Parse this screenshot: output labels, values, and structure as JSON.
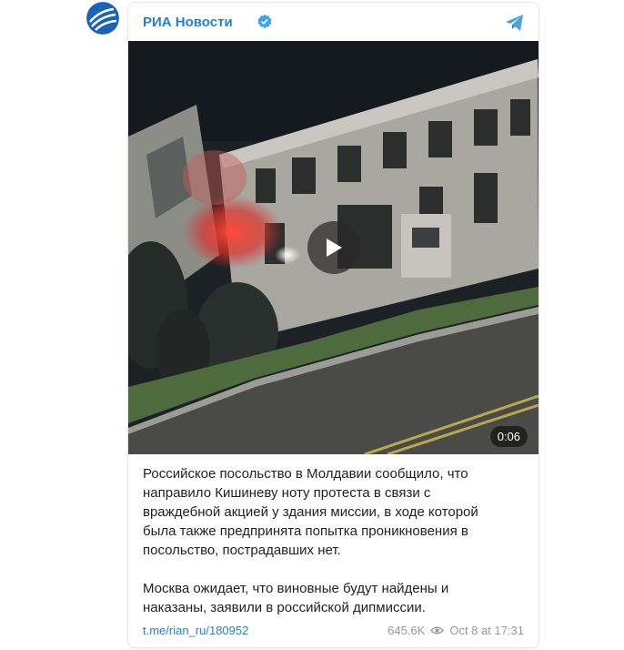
{
  "channel": {
    "name": "РИА Новости",
    "verified": true
  },
  "video": {
    "duration": "0:06"
  },
  "post": {
    "paragraphs": [
      "Российское посольство в Молдавии сообщило, что\nнаправило Кишиневу ноту протеста в связи с\nвраждебной акцией у здания миссии, в ходе которой\nбыла также предпринята попытка проникновения в\nпосольство, пострадавших нет.",
      "Москва ожидает, что виновные будут найдены и\nнаказаны, заявили в российской дипмиссии."
    ],
    "link": "t.me/rian_ru/180952",
    "views": "645.6K",
    "date": "Oct 8 at 17:31"
  },
  "colors": {
    "accent": "#2481cc",
    "meta": "#999999"
  },
  "icons": [
    "ria-logo",
    "verified-icon",
    "telegram-icon",
    "play-icon",
    "eye-icon"
  ]
}
